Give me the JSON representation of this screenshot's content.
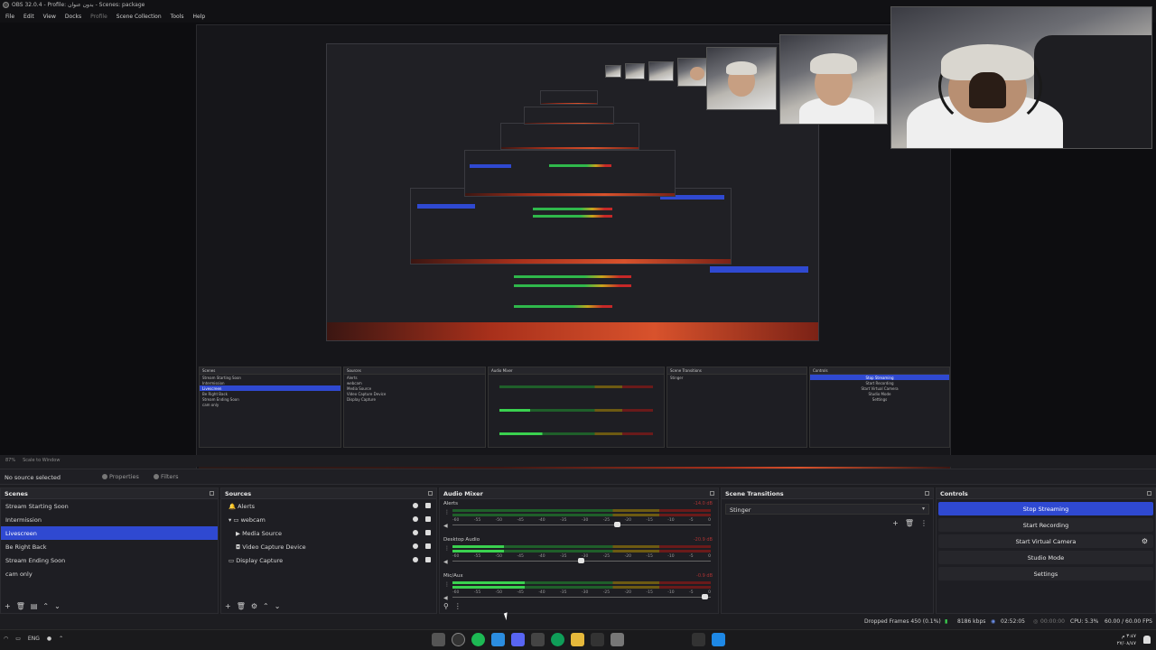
{
  "window": {
    "title": "OBS 32.0.4 - Profile: بدون عنوان - Scenes: package"
  },
  "menu": [
    "File",
    "Edit",
    "View",
    "Docks",
    "Profile",
    "Scene Collection",
    "Tools",
    "Help"
  ],
  "preview_bar": {
    "zoom": "87%",
    "scale": "Scale to Window"
  },
  "properties_bar": {
    "status": "No source selected",
    "properties": "Properties",
    "filters": "Filters"
  },
  "scenes": {
    "title": "Scenes",
    "items": [
      "Stream Starting Soon",
      "Intermission",
      "Livescreen",
      "Be Right Back",
      "Stream Ending Soon",
      "cam only"
    ],
    "selected_index": 2
  },
  "sources": {
    "title": "Sources",
    "items": [
      {
        "label": "Alerts",
        "indent": 0,
        "icon": ""
      },
      {
        "label": "webcam",
        "indent": 1,
        "icon": "▾"
      },
      {
        "label": "Media Source",
        "indent": 2,
        "icon": "▶"
      },
      {
        "label": "Video Capture Device",
        "indent": 2,
        "icon": "◘"
      },
      {
        "label": "Display Capture",
        "indent": 0,
        "icon": "▭"
      }
    ]
  },
  "audio_mixer": {
    "title": "Audio Mixer",
    "ticks": [
      "-60",
      "-55",
      "-50",
      "-45",
      "-40",
      "-35",
      "-30",
      "-25",
      "-20",
      "-15",
      "-10",
      "-5",
      "0"
    ],
    "channels": [
      {
        "name": "Alerts",
        "db": "-14.0 dB",
        "level": 0.0,
        "fader": 0.64
      },
      {
        "name": "Desktop Audio",
        "db": "-20.9 dB",
        "level": 0.2,
        "fader": 0.5
      },
      {
        "name": "Mic/Aux",
        "db": "-0.9 dB",
        "level": 0.28,
        "fader": 0.98
      }
    ]
  },
  "scene_transitions": {
    "title": "Scene Transitions",
    "selected": "Stinger"
  },
  "controls": {
    "title": "Controls",
    "buttons": [
      "Stop Streaming",
      "Start Recording",
      "Start Virtual Camera",
      "Studio Mode",
      "Settings"
    ],
    "active_index": 0
  },
  "status": {
    "dropped": "Dropped Frames 450 (0.1%)",
    "bitrate": "8186 kbps",
    "stream_time": "02:52:05",
    "rec_time": "00:00:00",
    "cpu": "CPU: 5.3%",
    "fps": "60.00 / 60.00 FPS"
  },
  "nested": {
    "scenes_title": "Scenes",
    "sources_title": "Sources",
    "mixer_title": "Audio Mixer",
    "trans_title": "Scene Transitions",
    "controls_title": "Controls",
    "no_source": "No source selected"
  },
  "taskbar": {
    "weather": "ENG",
    "clock_time": "٣:٤٧ م",
    "clock_date": "٢٧/٠٨/٤٧"
  },
  "colors": {
    "accent": "#2f49d1",
    "bg": "#1e1e23",
    "meter_green": "#3ad14f"
  }
}
